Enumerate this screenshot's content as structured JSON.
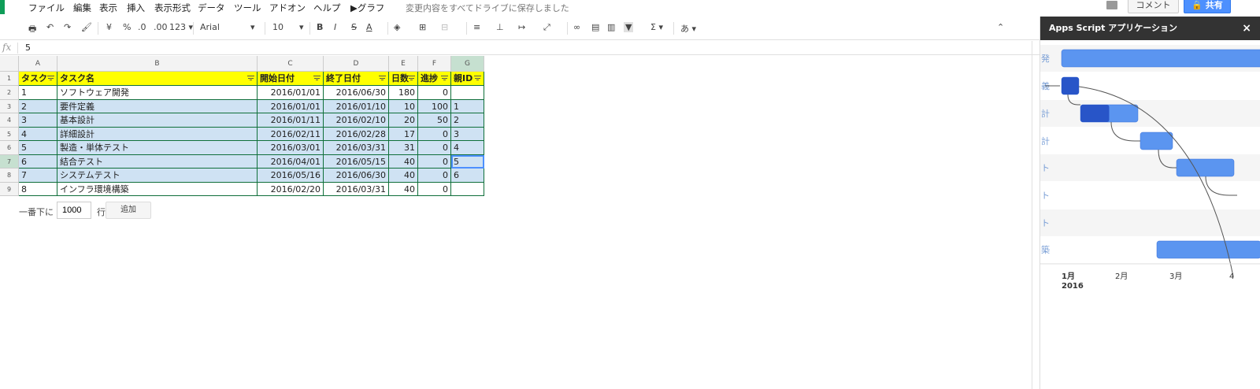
{
  "menubar": {
    "items": [
      "ファイル",
      "編集",
      "表示",
      "挿入",
      "表示形式",
      "データ",
      "ツール",
      "アドオン",
      "ヘルプ",
      "▶グラフ"
    ],
    "save_status": "変更内容をすべてドライブに保存しました",
    "comment_label": "コメント",
    "share_label": "🔒 共有"
  },
  "toolbar": {
    "print_icon": "🖶",
    "undo_icon": "↶",
    "redo_icon": "↷",
    "paint_icon": "🖌",
    "currency": "¥",
    "percent": "%",
    "decrease_decimal": ".0",
    "increase_decimal": ".00",
    "more_formats": "123 ▾",
    "font": "Arial",
    "font_size": "10",
    "bold": "B",
    "italic": "I",
    "strike": "S",
    "text_color": "A",
    "sigma": "Σ ▾",
    "input_tools": "あ ▾",
    "collapse": "⌃"
  },
  "formula_bar": {
    "fx": "fx",
    "value": "5"
  },
  "sheet": {
    "columns": [
      "A",
      "B",
      "C",
      "D",
      "E",
      "F",
      "G"
    ],
    "rows": [
      "1",
      "2",
      "3",
      "4",
      "5",
      "6",
      "7",
      "8",
      "9"
    ],
    "headers": [
      "タスク",
      "タスク名",
      "開始日付",
      "終了日付",
      "日数",
      "進捗",
      "親ID"
    ],
    "data": [
      [
        "1",
        "ソフトウェア開発",
        "2016/01/01",
        "2016/06/30",
        "180",
        "0",
        ""
      ],
      [
        "2",
        "要件定義",
        "2016/01/01",
        "2016/01/10",
        "10",
        "100",
        "1"
      ],
      [
        "3",
        "基本設計",
        "2016/01/11",
        "2016/02/10",
        "20",
        "50",
        "2"
      ],
      [
        "4",
        "詳細設計",
        "2016/02/11",
        "2016/02/28",
        "17",
        "0",
        "3"
      ],
      [
        "5",
        "製造・単体テスト",
        "2016/03/01",
        "2016/03/31",
        "31",
        "0",
        "4"
      ],
      [
        "6",
        "結合テスト",
        "2016/04/01",
        "2016/05/15",
        "40",
        "0",
        "5"
      ],
      [
        "7",
        "システムテスト",
        "2016/05/16",
        "2016/06/30",
        "40",
        "0",
        "6"
      ],
      [
        "8",
        "インフラ環境構築",
        "2016/02/20",
        "2016/03/31",
        "40",
        "0",
        ""
      ]
    ],
    "selected_cell": "G7"
  },
  "add_rows": {
    "prefix": "一番下に",
    "value": "1000",
    "suffix": "行",
    "button": "追加"
  },
  "sidebar": {
    "title": "Apps Script アプリケーション",
    "close": "×",
    "row_labels": [
      "発",
      "義",
      "計",
      "計",
      "ト",
      "ト",
      "ト",
      "築"
    ],
    "month_labels": [
      "1月",
      "2月",
      "3月",
      "4"
    ],
    "year_label": "2016"
  },
  "colors": {
    "bar_light": "#5b95f0",
    "bar_dark": "#2855c8",
    "header_yellow": "#ffff00",
    "row_band": "#cfe2f3",
    "accent_green": "#0f9d58"
  }
}
